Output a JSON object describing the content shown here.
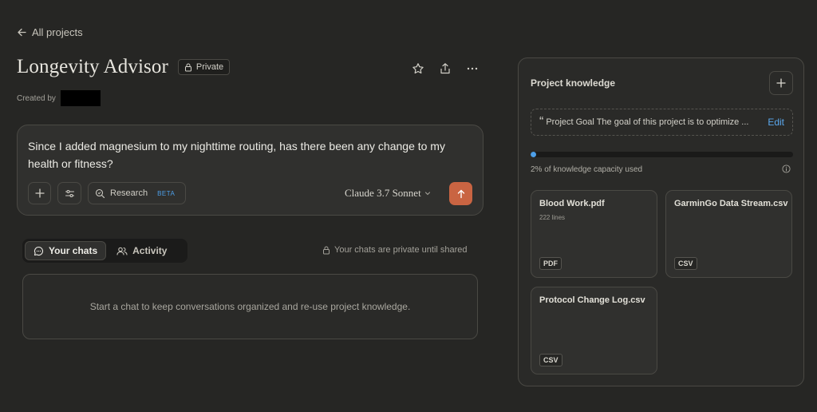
{
  "nav": {
    "back_label": "All projects"
  },
  "project": {
    "title": "Longevity Advisor",
    "visibility": "Private",
    "created_by_label": "Created by"
  },
  "composer": {
    "text": "Since I added magnesium to my nighttime routing, has there been any change to my health or fitness?",
    "research_label": "Research",
    "beta_label": "BETA",
    "model": "Claude 3.7 Sonnet"
  },
  "chats": {
    "tabs": [
      {
        "label": "Your chats",
        "icon": "chat-bubble-icon",
        "active": true
      },
      {
        "label": "Activity",
        "icon": "people-icon",
        "active": false
      }
    ],
    "private_note": "Your chats are private until shared",
    "empty_message": "Start a chat to keep conversations organized and re-use project knowledge."
  },
  "knowledge": {
    "title": "Project knowledge",
    "goal_text": "Project Goal The goal of this project is to optimize ...",
    "edit_label": "Edit",
    "capacity_fraction": 0.02,
    "capacity_label": "2% of knowledge capacity used",
    "files": [
      {
        "name": "Blood Work.pdf",
        "meta": "222 lines",
        "type": "PDF"
      },
      {
        "name": "GarminGo Data Stream.csv",
        "meta": "",
        "type": "CSV"
      },
      {
        "name": "Protocol Change Log.csv",
        "meta": "",
        "type": "CSV"
      }
    ]
  },
  "colors": {
    "background": "#262624",
    "accent": "#c96442",
    "link": "#5aa7ec"
  }
}
